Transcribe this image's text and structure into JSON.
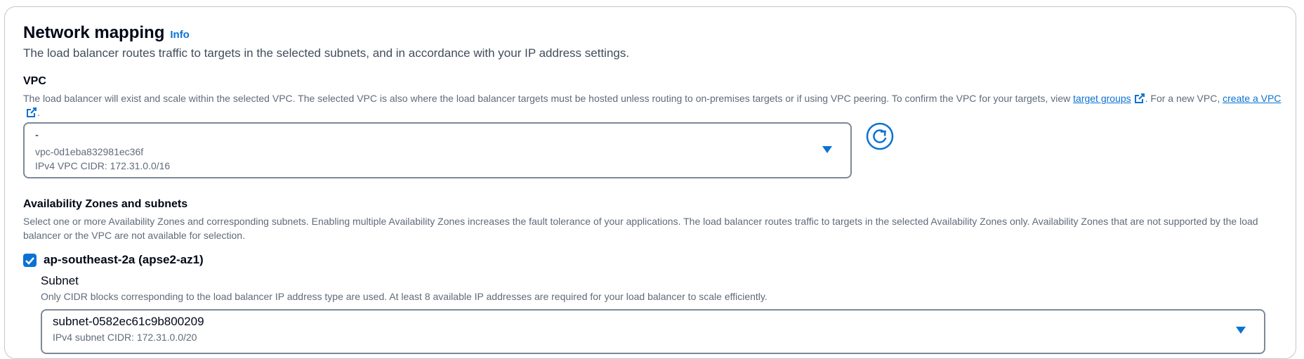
{
  "section": {
    "title": "Network mapping",
    "info_label": "Info",
    "description": "The load balancer routes traffic to targets in the selected subnets, and in accordance with your IP address settings."
  },
  "vpc": {
    "label": "VPC",
    "description_part1": "The load balancer will exist and scale within the selected VPC. The selected VPC is also where the load balancer targets must be hosted unless routing to on-premises targets or if using VPC peering. To confirm the VPC for your targets, view",
    "target_groups_link": "target groups",
    "description_part2": "For a new VPC,",
    "create_vpc_link": "create a VPC",
    "selected_name": "-",
    "selected_id": "vpc-0d1eba832981ec36f",
    "selected_cidr": "IPv4 VPC CIDR: 172.31.0.0/16"
  },
  "availability_zones": {
    "label": "Availability Zones and subnets",
    "description": "Select one or more Availability Zones and corresponding subnets. Enabling multiple Availability Zones increases the fault tolerance of your applications. The load balancer routes traffic to targets in the selected Availability Zones only. Availability Zones that are not supported by the load balancer or the VPC are not available for selection.",
    "zones": [
      {
        "name": "ap-southeast-2a (apse2-az1)",
        "checked": true,
        "subnet_label": "Subnet",
        "subnet_description": "Only CIDR blocks corresponding to the load balancer IP address type are used. At least 8 available IP addresses are required for your load balancer to scale efficiently.",
        "subnet_id": "subnet-0582ec61c9b800209",
        "subnet_cidr": "IPv4 subnet CIDR: 172.31.0.0/20"
      }
    ]
  },
  "colors": {
    "link": "#0972d3",
    "text": "#000716",
    "secondary_text": "#5f6b7a",
    "border": "#7d8998"
  },
  "icons": {
    "external_link": "external-link-icon",
    "refresh": "refresh-icon",
    "dropdown": "caret-down-icon",
    "checkbox": "checkmark-icon"
  }
}
